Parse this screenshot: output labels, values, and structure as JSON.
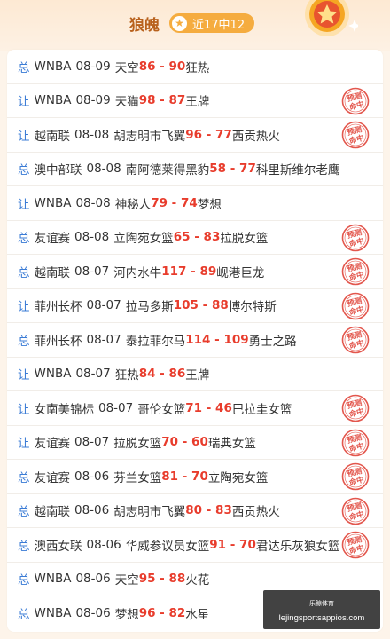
{
  "header": {
    "title": "狼魄",
    "badge": "近17中12"
  },
  "stamp_text": [
    "预测",
    "命中"
  ],
  "rows": [
    {
      "tag": "总",
      "league": "WNBA",
      "date": "08-09",
      "home": "天空",
      "home_score": "86",
      "away_score": "90",
      "away": "狂热",
      "hit": false
    },
    {
      "tag": "让",
      "league": "WNBA",
      "date": "08-09",
      "home": "天猫",
      "home_score": "98",
      "away_score": "87",
      "away": "王牌",
      "hit": true
    },
    {
      "tag": "让",
      "league": "越南联",
      "date": "08-08",
      "home": "胡志明市飞翼",
      "home_score": "96",
      "away_score": "77",
      "away": "西贡热火",
      "hit": true
    },
    {
      "tag": "总",
      "league": "澳中部联",
      "date": "08-08",
      "home": "南阿德莱得黑豹",
      "home_score": "58",
      "away_score": "77",
      "away": "科里斯维尔老鹰",
      "hit": false
    },
    {
      "tag": "让",
      "league": "WNBA",
      "date": "08-08",
      "home": "神秘人",
      "home_score": "79",
      "away_score": "74",
      "away": "梦想",
      "hit": false
    },
    {
      "tag": "总",
      "league": "友谊赛",
      "date": "08-08",
      "home": "立陶宛女篮",
      "home_score": "65",
      "away_score": "83",
      "away": "拉脱女篮",
      "hit": true
    },
    {
      "tag": "总",
      "league": "越南联",
      "date": "08-07",
      "home": "河内水牛",
      "home_score": "117",
      "away_score": "89",
      "away": "岘港巨龙",
      "hit": true
    },
    {
      "tag": "让",
      "league": "菲州长杯",
      "date": "08-07",
      "home": "拉马多斯",
      "home_score": "105",
      "away_score": "88",
      "away": "博尔特斯",
      "hit": true
    },
    {
      "tag": "总",
      "league": "菲州长杯",
      "date": "08-07",
      "home": "泰拉菲尔马",
      "home_score": "114",
      "away_score": "109",
      "away": "勇士之路",
      "hit": true
    },
    {
      "tag": "让",
      "league": "WNBA",
      "date": "08-07",
      "home": "狂热",
      "home_score": "84",
      "away_score": "86",
      "away": "王牌",
      "hit": false
    },
    {
      "tag": "让",
      "league": "女南美锦标",
      "date": "08-07",
      "home": "哥伦女篮",
      "home_score": "71",
      "away_score": "46",
      "away": "巴拉圭女篮",
      "hit": true
    },
    {
      "tag": "让",
      "league": "友谊赛",
      "date": "08-07",
      "home": "拉脱女篮",
      "home_score": "70",
      "away_score": "60",
      "away": "瑞典女篮",
      "hit": true
    },
    {
      "tag": "总",
      "league": "友谊赛",
      "date": "08-06",
      "home": "芬兰女篮",
      "home_score": "81",
      "away_score": "70",
      "away": "立陶宛女篮",
      "hit": true
    },
    {
      "tag": "总",
      "league": "越南联",
      "date": "08-06",
      "home": "胡志明市飞翼",
      "home_score": "80",
      "away_score": "83",
      "away": "西贡热火",
      "hit": true
    },
    {
      "tag": "总",
      "league": "澳西女联",
      "date": "08-06",
      "home": "华威参议员女篮",
      "home_score": "91",
      "away_score": "70",
      "away": "君达乐灰狼女篮",
      "hit": true
    },
    {
      "tag": "总",
      "league": "WNBA",
      "date": "08-06",
      "home": "天空",
      "home_score": "95",
      "away_score": "88",
      "away": "火花",
      "hit": false
    },
    {
      "tag": "总",
      "league": "WNBA",
      "date": "08-06",
      "home": "梦想",
      "home_score": "96",
      "away_score": "82",
      "away": "水星",
      "hit": false
    }
  ],
  "watermark": {
    "line1": "乐鲸体育",
    "line2": "lejingsportsappios.com"
  },
  "colors": {
    "tag": "#3a7bd5",
    "score": "#e83c2c",
    "stamp": "#e0453a",
    "title": "#b8611c",
    "badge": "#f5ac3f"
  }
}
